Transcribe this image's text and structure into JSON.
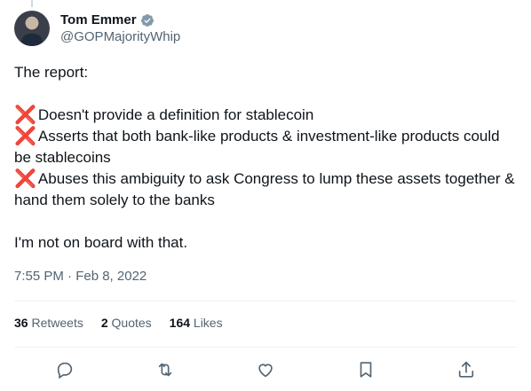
{
  "user": {
    "display_name": "Tom Emmer",
    "handle": "@GOPMajorityWhip",
    "verified": true,
    "verified_color": "#829aab"
  },
  "tweet": {
    "intro": "The report:",
    "bullets": [
      "Doesn't provide a definition for stablecoin",
      "Asserts that both bank-like products & investment-like products could be stablecoins",
      "Abuses this ambiguity to ask Congress to lump these assets together & hand them solely to the banks"
    ],
    "bullet_mark": "❌",
    "outro": "I'm not on board with that.",
    "timestamp": "7:55 PM · Feb 8, 2022"
  },
  "stats": {
    "retweets_count": "36",
    "retweets_label": "Retweets",
    "quotes_count": "2",
    "quotes_label": "Quotes",
    "likes_count": "164",
    "likes_label": "Likes"
  },
  "actions": {
    "icons": [
      "reply-icon",
      "retweet-icon",
      "like-icon",
      "bookmark-icon",
      "share-icon"
    ]
  }
}
